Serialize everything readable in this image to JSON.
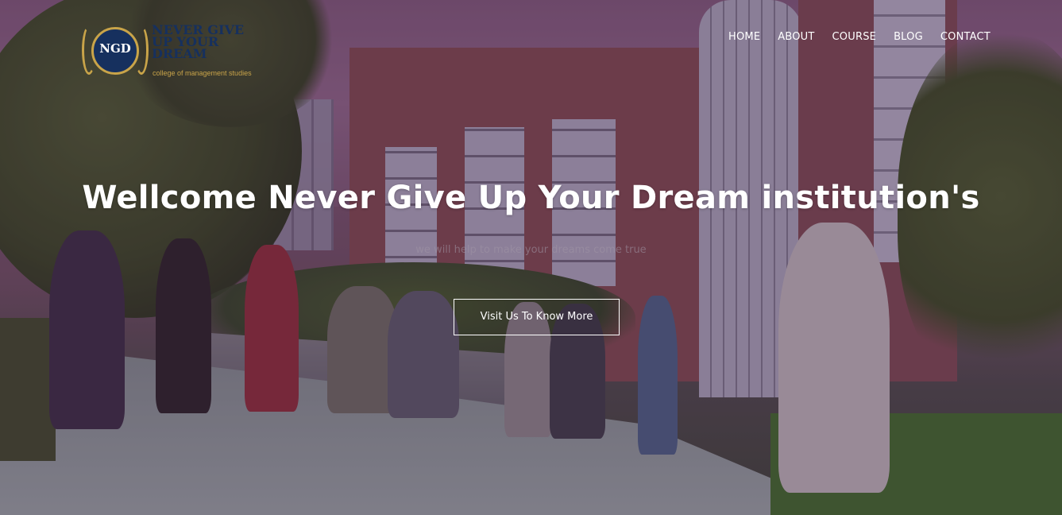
{
  "logo": {
    "initials": "NGD",
    "title_lines": [
      "NEVER GIVE",
      "UP YOUR",
      "DREAM"
    ],
    "tagline": "college of management studies"
  },
  "nav": {
    "items": [
      {
        "label": "HOME"
      },
      {
        "label": "ABOUT"
      },
      {
        "label": "COURSE"
      },
      {
        "label": "BLOG"
      },
      {
        "label": "CONTACT"
      }
    ]
  },
  "hero": {
    "title": "Wellcome Never Give Up Your Dream institution's",
    "subtitle": "we will help to make your dreams come true",
    "cta_label": "Visit Us To Know More"
  },
  "colors": {
    "logo_navy": "#16305e",
    "logo_gold": "#c9a449",
    "overlay": "#3c143c"
  }
}
